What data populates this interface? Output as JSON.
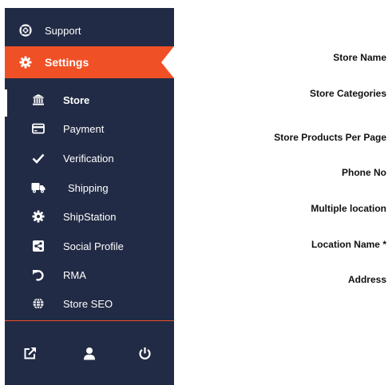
{
  "sidebar": {
    "support_label": "Support",
    "settings_label": "Settings",
    "items": [
      {
        "label": "Store",
        "icon": "bank-icon"
      },
      {
        "label": "Payment",
        "icon": "credit-card-icon"
      },
      {
        "label": "Verification",
        "icon": "check-icon"
      },
      {
        "label": "Shipping",
        "icon": "truck-icon"
      },
      {
        "label": "ShipStation",
        "icon": "gear-icon"
      },
      {
        "label": "Social Profile",
        "icon": "share-icon"
      },
      {
        "label": "RMA",
        "icon": "undo-icon"
      },
      {
        "label": "Store SEO",
        "icon": "globe-icon"
      }
    ],
    "footer": [
      "external-link-icon",
      "user-icon",
      "power-icon"
    ]
  },
  "form": {
    "labels": [
      "Store Name",
      "Store Categories",
      "Store Products Per Page",
      "Phone No",
      "Multiple location",
      "Location Name *",
      "Address"
    ]
  },
  "colors": {
    "sidebar_bg": "#222b45",
    "accent": "#f05025",
    "text_light": "#ffffff"
  }
}
